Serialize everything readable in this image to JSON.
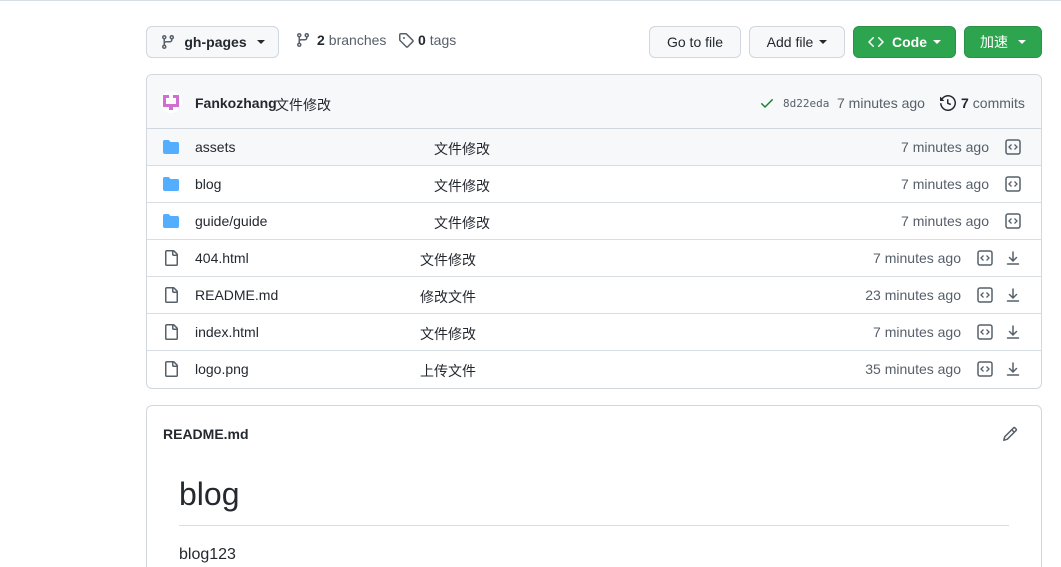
{
  "toolbar": {
    "branch_label": "gh-pages",
    "branches_count": "2",
    "branches_label": "branches",
    "tags_count": "0",
    "tags_label": "tags",
    "go_to_file": "Go to file",
    "add_file": "Add file",
    "code": "Code",
    "accelerate": "加速"
  },
  "commit": {
    "author": "Fankozhang",
    "message": "文件修改",
    "sha": "8d22eda",
    "time": "7 minutes ago",
    "commits_count": "7",
    "commits_label": "commits"
  },
  "files": [
    {
      "type": "dir",
      "name": "assets",
      "message": "文件修改",
      "time": "7 minutes ago"
    },
    {
      "type": "dir",
      "name": "blog",
      "message": "文件修改",
      "time": "7 minutes ago"
    },
    {
      "type": "dir",
      "name": "guide/guide",
      "message": "文件修改",
      "time": "7 minutes ago"
    },
    {
      "type": "file",
      "name": "404.html",
      "message": "文件修改",
      "time": "7 minutes ago"
    },
    {
      "type": "file",
      "name": "README.md",
      "message": "修改文件",
      "time": "23 minutes ago"
    },
    {
      "type": "file",
      "name": "index.html",
      "message": "文件修改",
      "time": "7 minutes ago"
    },
    {
      "type": "file",
      "name": "logo.png",
      "message": "上传文件",
      "time": "35 minutes ago"
    }
  ],
  "readme": {
    "filename": "README.md",
    "heading": "blog",
    "body": "blog123"
  },
  "colors": {
    "green": "#2da44e",
    "folder": "#54aeff",
    "link": "#24292f",
    "muted": "#57606a",
    "avatar": "#d16ed1"
  },
  "icons": [
    "branch-icon",
    "tag-icon",
    "code-icon",
    "check-icon",
    "history-icon",
    "folder-icon",
    "file-icon",
    "view-code-icon",
    "download-icon",
    "pencil-icon",
    "avatar"
  ]
}
